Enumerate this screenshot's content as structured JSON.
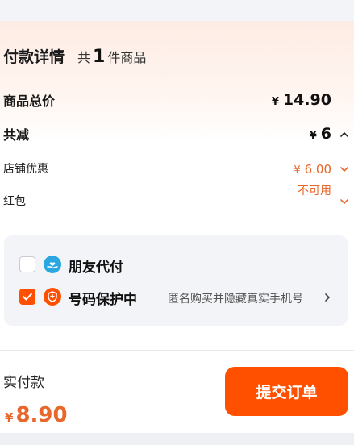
{
  "summary": {
    "title": "付款详情",
    "count_prefix": "共",
    "count": "1",
    "count_suffix": "件商品"
  },
  "rows": {
    "total_label": "商品总价",
    "total_currency": "¥",
    "total_value": "14.90",
    "discount_label": "共减",
    "discount_currency": "¥",
    "discount_value": "6",
    "shop_label": "店铺优惠",
    "shop_currency": "¥",
    "shop_value": "6.00",
    "redpacket_label": "红包",
    "redpacket_value": "不可用"
  },
  "options": {
    "friend_pay_label": "朋友代付",
    "friend_pay_checked": false,
    "privacy_label": "号码保护中",
    "privacy_checked": true,
    "privacy_desc": "匿名购买并隐藏真实手机号"
  },
  "footer": {
    "paid_label": "实付款",
    "paid_currency": "¥",
    "paid_value": "8.90",
    "submit_label": "提交订单"
  },
  "colors": {
    "accent": "#ff5000",
    "price_orange": "#e8672a",
    "friend_icon": "#2aa7e0"
  },
  "icons": [
    "chevron-up-icon",
    "chevron-down-icon",
    "checkmark-icon",
    "hand-heart-icon",
    "shield-icon",
    "chevron-right-icon"
  ]
}
